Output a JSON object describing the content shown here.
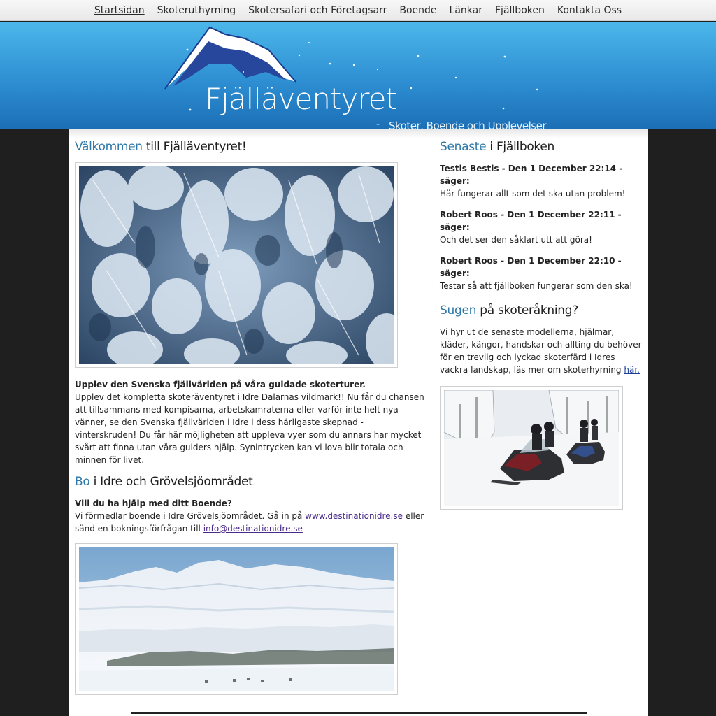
{
  "nav": {
    "items": [
      {
        "label": "Startsidan",
        "active": true
      },
      {
        "label": "Skoteruthyrning"
      },
      {
        "label": "Skotersafari och Företagsarr"
      },
      {
        "label": "Boende"
      },
      {
        "label": "Länkar"
      },
      {
        "label": "Fjällboken"
      },
      {
        "label": "Kontakta Oss"
      }
    ]
  },
  "header": {
    "title": "Fjälläventyret",
    "separator": "-",
    "tagline": "Skoter, Boende och Upplevelser"
  },
  "welcome": {
    "heading_highlight": "Välkommen",
    "heading_rest": " till Fjälläventyret!",
    "intro_bold": "Upplev den Svenska fjällvärlden på våra guidade skoterturer.",
    "intro_text": "Upplev det kompletta skoteräventyret i Idre Dalarnas vildmark!! Nu får du chansen att tillsammans med kompisarna, arbetskamraterna eller varför inte helt nya vänner, se den Svenska fjällvärlden i Idre i dess härligaste skepnad - vinterskruden! Du får här möjligheten att uppleva vyer som du annars har mycket svårt att finna utan våra guiders hjälp. Synintrycken kan vi lova blir totala och minnen för livet."
  },
  "stay": {
    "heading_highlight": "Bo",
    "heading_rest": " i Idre och Grövelsjöområdet",
    "question": "Vill du ha hjälp med ditt Boende?",
    "text_1": "Vi förmedlar boende i Idre Grövelsjöområdet. Gå in på ",
    "link_1": "www.destinationidre.se",
    "text_2": " eller sänd en bokningsförfrågan till ",
    "link_2": "info@destinationidre.se"
  },
  "guestbook": {
    "heading_highlight": "Senaste",
    "heading_rest": " i Fjällboken",
    "entries": [
      {
        "meta": "Testis Bestis - Den 1 December 22:14 - säger:",
        "text": "Här fungerar allt som det ska utan problem!"
      },
      {
        "meta": "Robert Roos - Den 1 December 22:11 - säger:",
        "text": "Och det ser den såklart utt att göra!"
      },
      {
        "meta": "Robert Roos - Den 1 December 22:10 - säger:",
        "text": "Testar så att fjällboken fungerar som den ska!"
      }
    ]
  },
  "rental": {
    "heading_highlight": "Sugen",
    "heading_rest": " på skoteråkning?",
    "text": "Vi hyr ut de senaste modellerna, hjälmar, kläder, kängor, handskar och allting du behöver för en trevlig och lyckad skoterfärd i Idres vackra landskap, läs mer om skoterhyrning ",
    "link": "här."
  },
  "colors": {
    "accent": "#2d78a8",
    "banner_top": "#4cb7ea",
    "banner_bottom": "#1c6fb6",
    "page_bg": "#1f1f1f",
    "link": "#4a2a8a"
  }
}
